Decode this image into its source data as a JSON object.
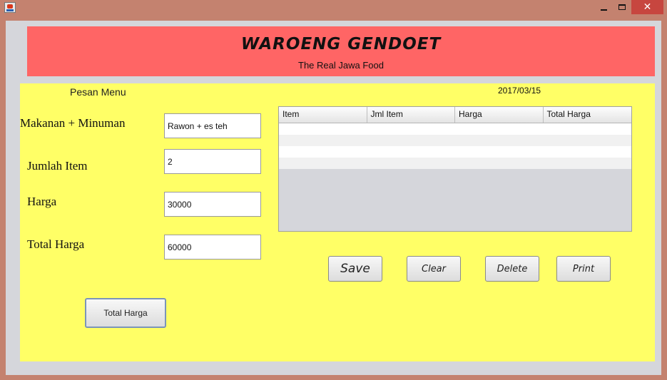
{
  "window": {
    "icon": "java-cup-icon",
    "controls": {
      "minimize": "minimize-icon",
      "maximize": "maximize-icon",
      "close": "✕"
    }
  },
  "header": {
    "title": "WAROENG GENDOET",
    "subtitle": "The Real Jawa Food",
    "color": "#ff6565"
  },
  "panel": {
    "label": "Pesan Menu",
    "date": "2017/03/15",
    "color": "#ffff66"
  },
  "form": {
    "makanan_label": "Makanan + Minuman",
    "makanan_value": "Rawon + es teh",
    "jumlah_label": "Jumlah Item",
    "jumlah_value": "2",
    "harga_label": "Harga",
    "harga_value": "30000",
    "total_label": "Total Harga",
    "total_value": "60000",
    "total_button": "Total Harga"
  },
  "table": {
    "columns": [
      "Item",
      "Jml Item",
      "Harga",
      "Total Harga"
    ],
    "rows": []
  },
  "actions": {
    "save": "Save",
    "clear": "Clear",
    "delete": "Delete",
    "print": "Print"
  }
}
